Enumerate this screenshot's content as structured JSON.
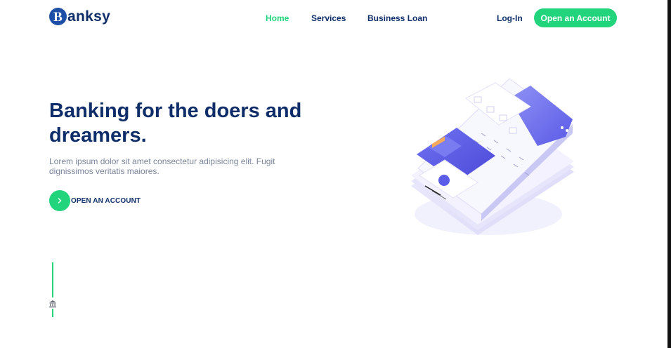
{
  "brand": {
    "name": "anksy",
    "logo_letter": "B"
  },
  "nav": {
    "items": [
      {
        "label": "Home",
        "active": true
      },
      {
        "label": "Services",
        "active": false
      },
      {
        "label": "Business Loan",
        "active": false
      }
    ],
    "login_label": "Log-In",
    "open_account_label": "Open an Account"
  },
  "hero": {
    "title_line1": "Banking for the doers and",
    "title_line2": "dreamers.",
    "description": "Lorem ipsum dolor sit amet consectetur adipisicing elit. Fugit dignissimos veritatis maiores.",
    "cta_label": "OPEN AN ACCOUNT"
  },
  "icons": {
    "cta": "chevron-right-icon",
    "scroll": "bank-icon",
    "logo": "b-monogram-icon"
  },
  "colors": {
    "accent": "#22d47c",
    "navy": "#0f2e69",
    "text_muted": "#7a8499",
    "illustration_primary": "#5b5de8",
    "illustration_light": "#e8e7fb"
  }
}
